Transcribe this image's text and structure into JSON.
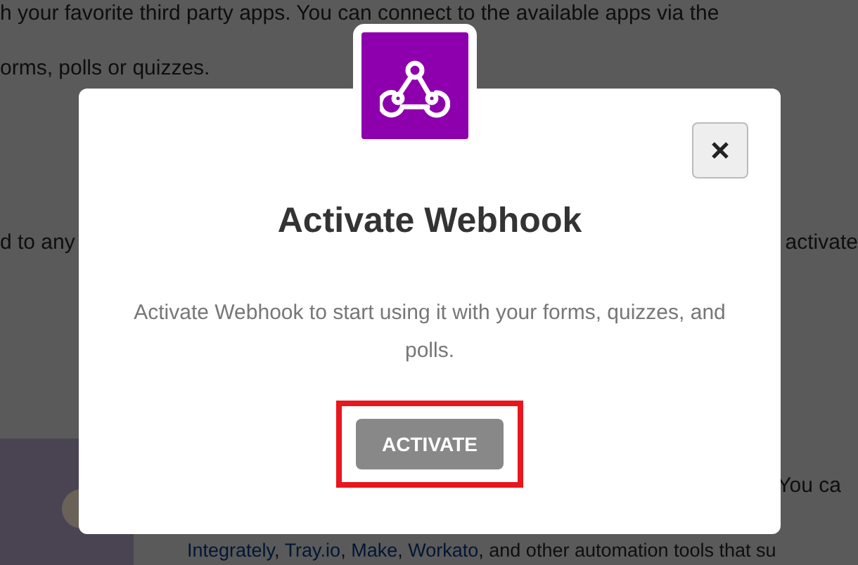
{
  "page": {
    "intro_lines": [
      "h your favorite third party apps. You can connect to the available apps via the",
      "orms, polls or quizzes."
    ],
    "middle_left": "d to any",
    "middle_right": "activate",
    "bottom_right": "You ca",
    "bottom_line": "**Integrately**, **Tray.io**, **Make**, **Workato**, and other automation tools that su"
  },
  "dialog": {
    "title": "Activate Webhook",
    "message": "Activate Webhook to start using it with your forms, quizzes, and polls.",
    "button": "ACTIVATE",
    "button_highlighted": true
  }
}
